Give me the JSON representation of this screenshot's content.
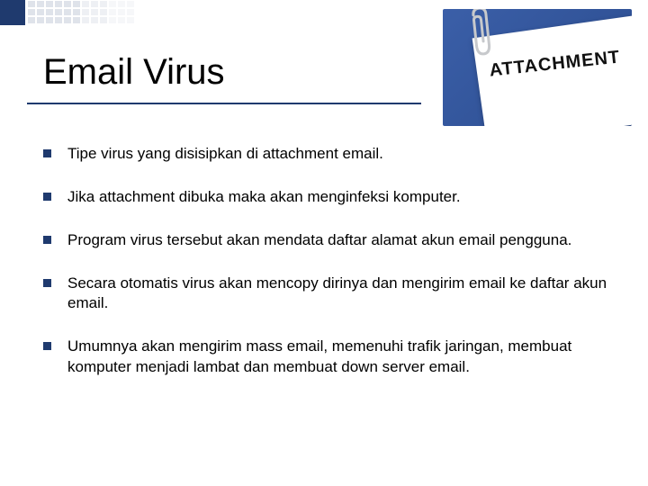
{
  "slide": {
    "title": "Email Virus",
    "image_label": "ATTACHMENT",
    "bullets": [
      "Tipe virus yang disisipkan di attachment email.",
      "Jika attachment dibuka maka akan menginfeksi komputer.",
      "Program virus tersebut akan mendata daftar alamat akun email pengguna.",
      "Secara otomatis virus akan mencopy dirinya dan mengirim email ke daftar akun email.",
      "Umumnya akan mengirim mass email, memenuhi trafik jaringan, membuat komputer menjadi lambat dan membuat down server email."
    ]
  }
}
